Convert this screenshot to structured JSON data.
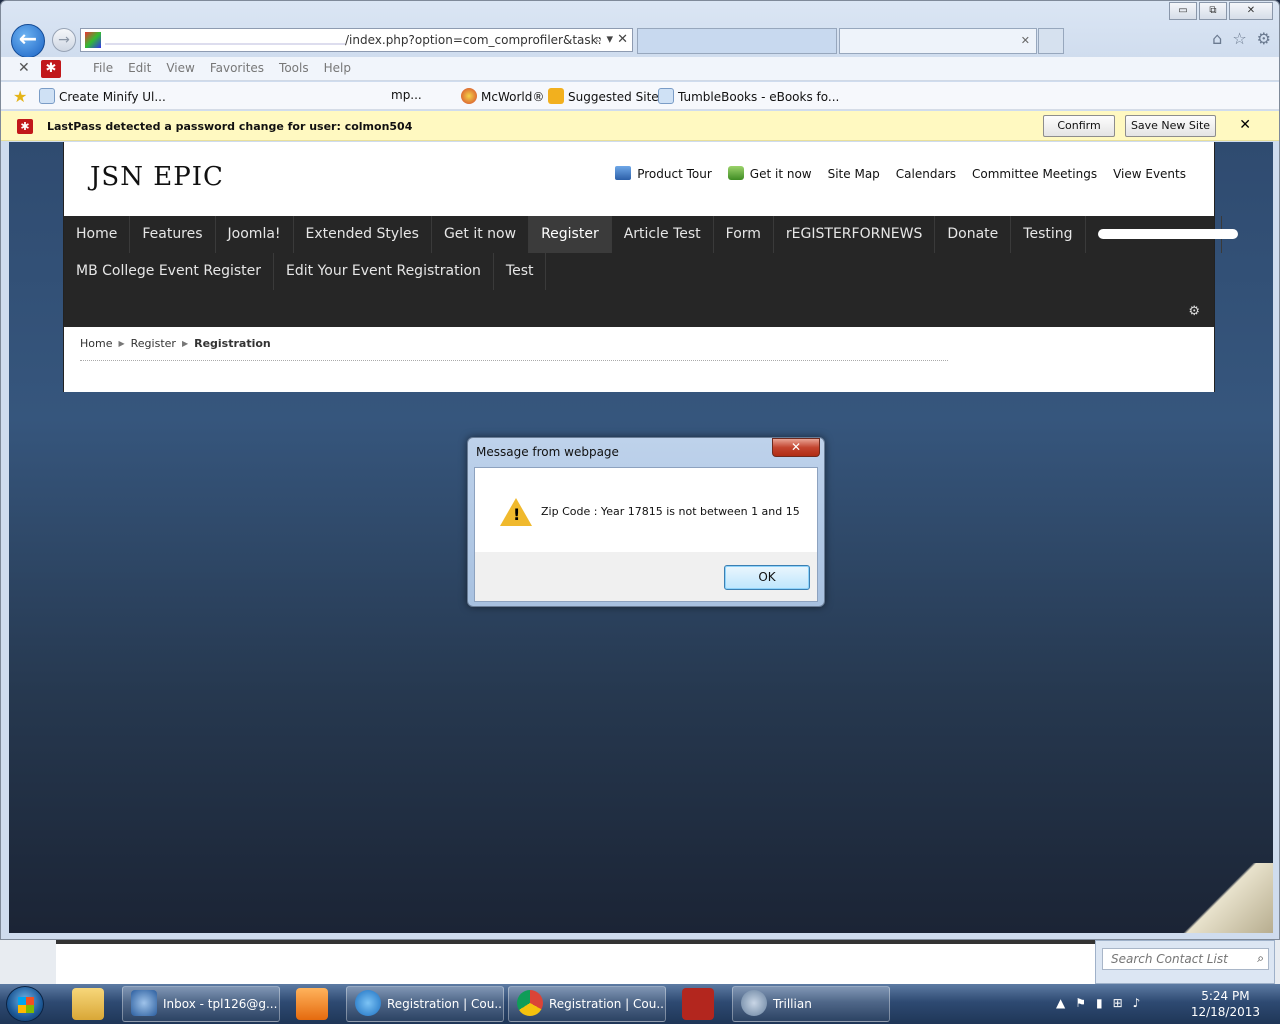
{
  "browser": {
    "address_url": "/index.php?option=com_comprofiler&task:",
    "address_controls": "⌕ ▾ ✕",
    "window_controls": {
      "minimize": "▭",
      "restore": "⧉",
      "close": "✕"
    },
    "menu": [
      "File",
      "Edit",
      "View",
      "Favorites",
      "Tools",
      "Help"
    ],
    "favorites": [
      {
        "label": "Create Minify Ul...",
        "icon": "page-icon"
      },
      {
        "label": "mp...",
        "icon": "page-icon"
      },
      {
        "label": "McWorld®",
        "icon": "mcworld-icon"
      },
      {
        "label": "Suggested Sites",
        "icon": "bing-icon"
      },
      {
        "label": "TumbleBooks - eBooks fo...",
        "icon": "page-icon"
      }
    ]
  },
  "lastpass": {
    "message": "LastPass detected a password change for user: colmon504",
    "confirm_label": "Confirm",
    "save_label": "Save New Site",
    "close": "✕"
  },
  "site": {
    "logo": "JSN EPIC",
    "top_links": [
      "Product Tour",
      "Get it now",
      "Site Map",
      "Calendars",
      "Committee Meetings",
      "View Events"
    ],
    "nav_row1": [
      "Home",
      "Features",
      "Joomla!",
      "Extended Styles",
      "Get it now",
      "Register",
      "Article Test",
      "Form",
      "rEGISTERFORNEWS",
      "Donate",
      "Testing"
    ],
    "nav_row2": [
      "MB College Event Register",
      "Edit Your Event Registration",
      "Test"
    ],
    "active_nav": "Register",
    "breadcrumb": [
      "Home",
      "Register",
      "Registration"
    ]
  },
  "dialog": {
    "title": "Message from webpage",
    "message": "Zip Code : Year 17815 is not between 1 and 15",
    "ok_label": "OK",
    "close": "✕"
  },
  "contact_search": {
    "placeholder": "Search Contact List"
  },
  "taskbar": {
    "buttons": [
      {
        "label": "Inbox - tpl126@g...",
        "icon": "thunderbird-icon"
      },
      {
        "label": "Registration | Cou...",
        "icon": "ie-icon"
      },
      {
        "label": "Registration | Cou...",
        "icon": "chrome-icon"
      },
      {
        "label": "Trillian",
        "icon": "trillian-icon"
      }
    ],
    "time": "5:24 PM",
    "date": "12/18/2013"
  },
  "colors": {
    "nav_bg": "#262626",
    "lastpass_bar": "#fff9c1",
    "page_bg": "#2f4b70"
  }
}
